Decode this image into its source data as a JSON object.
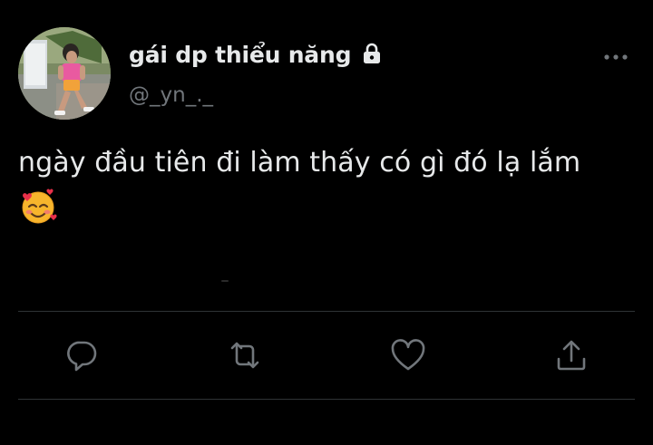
{
  "tweet": {
    "display_name": "gái dp thiểu năng",
    "handle": "@_yn_._",
    "protected_icon": "lock-icon",
    "more_icon": "more-dots-icon",
    "text": "ngày đầu tiên đi làm thấy có gì đó lạ lắm",
    "emoji": "smiling-face-with-hearts-icon"
  },
  "actions": [
    {
      "name": "reply",
      "icon": "reply-icon"
    },
    {
      "name": "retweet",
      "icon": "retweet-icon"
    },
    {
      "name": "like",
      "icon": "heart-icon"
    },
    {
      "name": "share",
      "icon": "share-icon"
    }
  ],
  "colors": {
    "background": "#000000",
    "primary_text": "#e7e9ea",
    "secondary_text": "#71767b",
    "divider": "#2f3336"
  }
}
